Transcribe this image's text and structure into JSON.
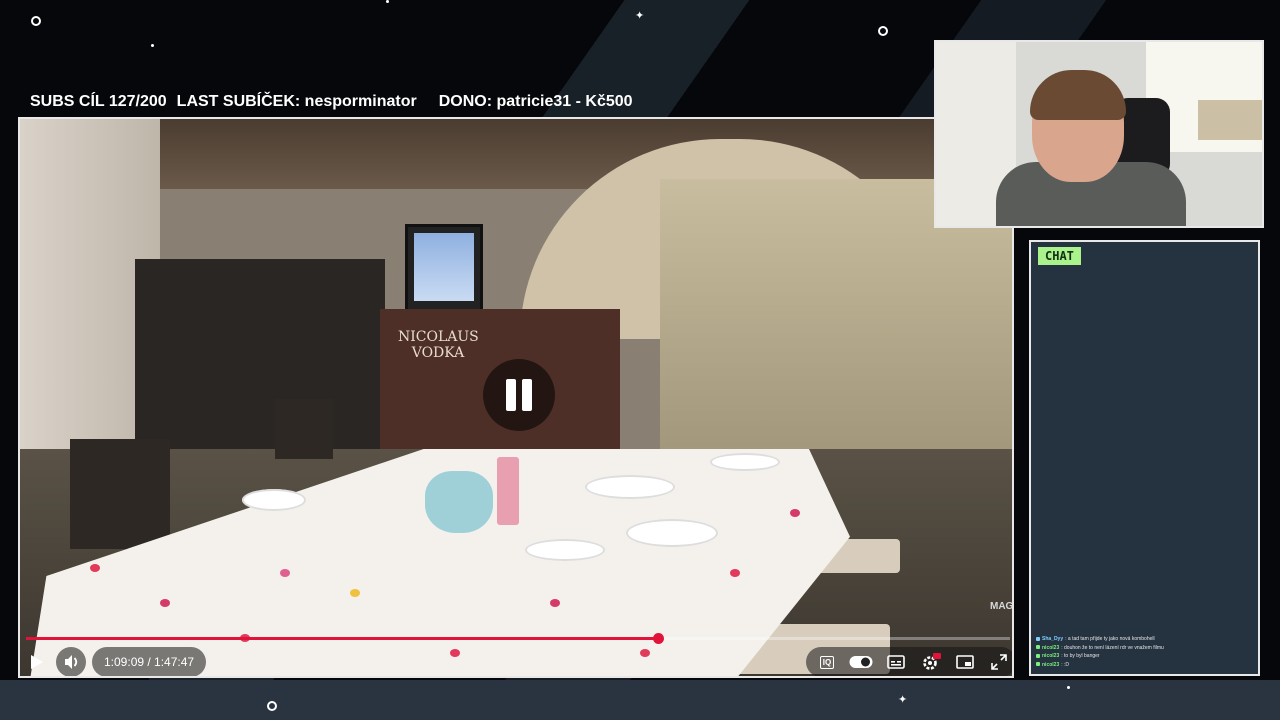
{
  "overlay": {
    "subs_goal": "SUBS CÍL 127/200",
    "last_sub": "LAST SUBÍČEK: nesporminator",
    "donation": "DONO: patricie31 - Kč500"
  },
  "video": {
    "current_time": "1:09:09",
    "duration": "1:47:47",
    "time_display": "1:09:09 / 1:47:47",
    "progress_percent": 64.2,
    "state": "playing",
    "pause_icon": "pause-icon",
    "scene_text": {
      "bar_sign": "NICOLAUS VODKA",
      "watermark": "MAG"
    },
    "controls": [
      {
        "name": "play-button",
        "icon": "play-icon"
      },
      {
        "name": "volume-button",
        "icon": "volume-icon"
      },
      {
        "name": "iq-button",
        "icon": "iq-icon",
        "label": "IQ"
      },
      {
        "name": "autoplay-toggle",
        "icon": "toggle-icon"
      },
      {
        "name": "subtitles-button",
        "icon": "subtitles-icon"
      },
      {
        "name": "settings-button",
        "icon": "gear-icon",
        "badge": "HD"
      },
      {
        "name": "miniplayer-button",
        "icon": "miniplayer-icon"
      },
      {
        "name": "fullscreen-button",
        "icon": "fullscreen-icon"
      }
    ],
    "accent_color": "#e2133b"
  },
  "chat": {
    "title": "CHAT",
    "badge_color": "#a9f28c",
    "messages": [
      {
        "user": "Sha_Dyy",
        "text": ": a tad tam přijde ty jako nová kombohell",
        "color": "#7fd0ff"
      },
      {
        "user": "nicol23",
        "text": ": douhon že to není lázení rdr ve vnažem filmu",
        "color": "#7cf07c"
      },
      {
        "user": "nicol23",
        "text": ": to by byl banger",
        "color": "#7cf07c"
      },
      {
        "user": "nicol23",
        "text": ": :D",
        "color": "#7cf07c"
      }
    ]
  }
}
